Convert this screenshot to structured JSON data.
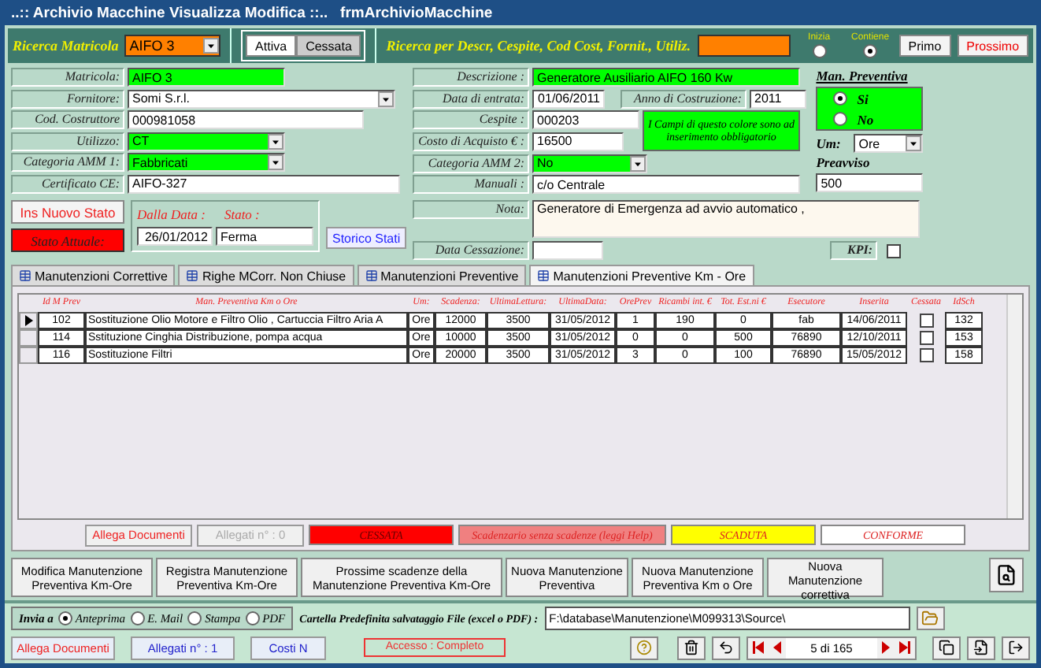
{
  "window": {
    "title": "..:: Archivio Macchine Visualizza Modifica ::..   frmArchivioMacchine"
  },
  "search": {
    "matricola_label": "Ricerca Matricola",
    "matricola_value": "AIFO 3",
    "toggle": [
      {
        "label": "Attiva",
        "selected": true
      },
      {
        "label": "Cessata",
        "selected": false
      }
    ],
    "desc_label": "Ricerca per Descr, Cespite, Cod Cost, Fornit., Utiliz.",
    "modes": [
      {
        "label": "Inizia",
        "selected": false
      },
      {
        "label": "Contiene",
        "selected": true
      }
    ],
    "buttons": [
      "Primo",
      "Prossimo"
    ]
  },
  "left_fields": [
    {
      "label": "Matricola:",
      "value": "AIFO 3",
      "required": true,
      "dropdown": false
    },
    {
      "label": "Fornitore:",
      "value": "Somi S.r.l.",
      "required": false,
      "dropdown": true
    },
    {
      "label": "Cod. Costruttore",
      "value": "000981058",
      "required": false,
      "dropdown": false
    },
    {
      "label": "Utilizzo:",
      "value": "CT",
      "required": true,
      "dropdown": true
    },
    {
      "label": "Categoria AMM 1:",
      "value": "Fabbricati",
      "required": true,
      "dropdown": true
    },
    {
      "label": "Certificato CE:",
      "value": "AIFO-327",
      "required": false,
      "dropdown": false
    }
  ],
  "state": {
    "button": "Ins Nuovo Stato",
    "current_label": "Stato Attuale:",
    "from_label": "Dalla Data :",
    "state_label": "Stato :",
    "date": "26/01/2012",
    "value": "Ferma",
    "history": "Storico Stati"
  },
  "right": {
    "descrizione": {
      "label": "Descrizione :",
      "value": "Generatore Ausiliario AIFO  160 Kw"
    },
    "entrata": {
      "label": "Data di entrata:",
      "value": "01/06/2011"
    },
    "anno": {
      "label": "Anno di Costruzione:",
      "value": "2011"
    },
    "cespite": {
      "label": "Cespite :",
      "value": "000203"
    },
    "note": "I Campi di questo colore sono ad inserimento obbligatorio",
    "costo": {
      "label": "Costo di Acquisto € :",
      "value": "16500"
    },
    "categoria": {
      "label": "Categoria AMM 2:",
      "value": "No"
    },
    "manuali": {
      "label": "Manuali :",
      "value": "c/o Centrale"
    },
    "nota": {
      "label": "Nota:",
      "value": "Generatore di Emergenza  ad avvio automatico ,"
    },
    "cessazione": {
      "label": "Data Cessazione:"
    },
    "preventiva": {
      "label": "Man. Preventiva",
      "options": [
        {
          "label": "Si",
          "selected": true
        },
        {
          "label": "No",
          "selected": false
        }
      ]
    },
    "um": {
      "label": "Um:",
      "value": "Ore"
    },
    "preavviso": {
      "label": "Preavviso",
      "value": "500"
    },
    "kpi": {
      "label": "KPI:",
      "checked": false
    }
  },
  "tabs": [
    {
      "label": "Manutenzioni Correttive",
      "selected": false
    },
    {
      "label": "Righe MCorr. Non Chiuse",
      "selected": false
    },
    {
      "label": "Manutenzioni Preventive",
      "selected": false
    },
    {
      "label": "Manutenzioni Preventive Km - Ore",
      "selected": true
    }
  ],
  "table": {
    "columns": [
      "Id M Prev",
      "Man. Preventiva Km o Ore",
      "Um:",
      "Scadenza:",
      "UltimaLettura:",
      "UltimaData:",
      "OrePrev",
      "Ricambi int. €",
      "Tot. Est.ni €",
      "Esecutore",
      "Inserita",
      "Cessata",
      "IdSch"
    ],
    "rows": [
      {
        "selected": true,
        "cells": [
          "102",
          "Sostituzione Olio Motore  e Filtro Olio ,  Cartuccia Filtro Aria A",
          "Ore",
          "12000",
          "3500",
          "31/05/2012",
          "1",
          "190",
          "0",
          "fab",
          "14/06/2011"
        ],
        "cessata": false,
        "idsch": "132"
      },
      {
        "selected": false,
        "cells": [
          "114",
          "Sstituzione Cinghia Distribuzione, pompa acqua",
          "Ore",
          "10000",
          "3500",
          "31/05/2012",
          "0",
          "0",
          "500",
          "76890",
          "12/10/2011"
        ],
        "cessata": false,
        "idsch": "153"
      },
      {
        "selected": false,
        "cells": [
          "116",
          "Sostituzione Filtri",
          "Ore",
          "20000",
          "3500",
          "31/05/2012",
          "3",
          "0",
          "100",
          "76890",
          "15/05/2012"
        ],
        "cessata": false,
        "idsch": "158"
      }
    ]
  },
  "attachments": [
    {
      "label": "Allega Documenti",
      "disabled": false
    },
    {
      "label": "Allegati n° : 0",
      "disabled": true
    }
  ],
  "legend": [
    {
      "label": "CESSATA",
      "color": "#ff0000"
    },
    {
      "label": "Scadenzario senza scadenze (leggi Help)",
      "color": "#f08080"
    },
    {
      "label": "SCADUTA",
      "color": "#ffff00"
    },
    {
      "label": "CONFORME",
      "color": "#ffffff"
    }
  ],
  "actions": [
    "Modifica Manutenzione Preventiva Km-Ore",
    "Registra Manutenzione Preventiva Km-Ore",
    "Prossime scadenze della Manutenzione Preventiva Km-Ore",
    "Nuova Manutenzione Preventiva",
    "Nuova Manutenzione Preventiva Km o Ore",
    "Nuova Manutenzione correttiva"
  ],
  "send": {
    "label": "Invia a",
    "options": [
      {
        "label": "Anteprima",
        "selected": true
      },
      {
        "label": "E. Mail",
        "selected": false
      },
      {
        "label": "Stampa",
        "selected": false
      },
      {
        "label": "PDF",
        "selected": false
      }
    ]
  },
  "folder": {
    "label": "Cartella Predefinita  salvataggio File (excel o PDF) :",
    "value": "F:\\database\\Manutenzione\\M099313\\Source\\"
  },
  "footer_buttons": [
    "Allega Documenti",
    "Allegati n° : 1",
    "Costi N"
  ],
  "access": "Accesso : Completo",
  "record": "5 di 165"
}
